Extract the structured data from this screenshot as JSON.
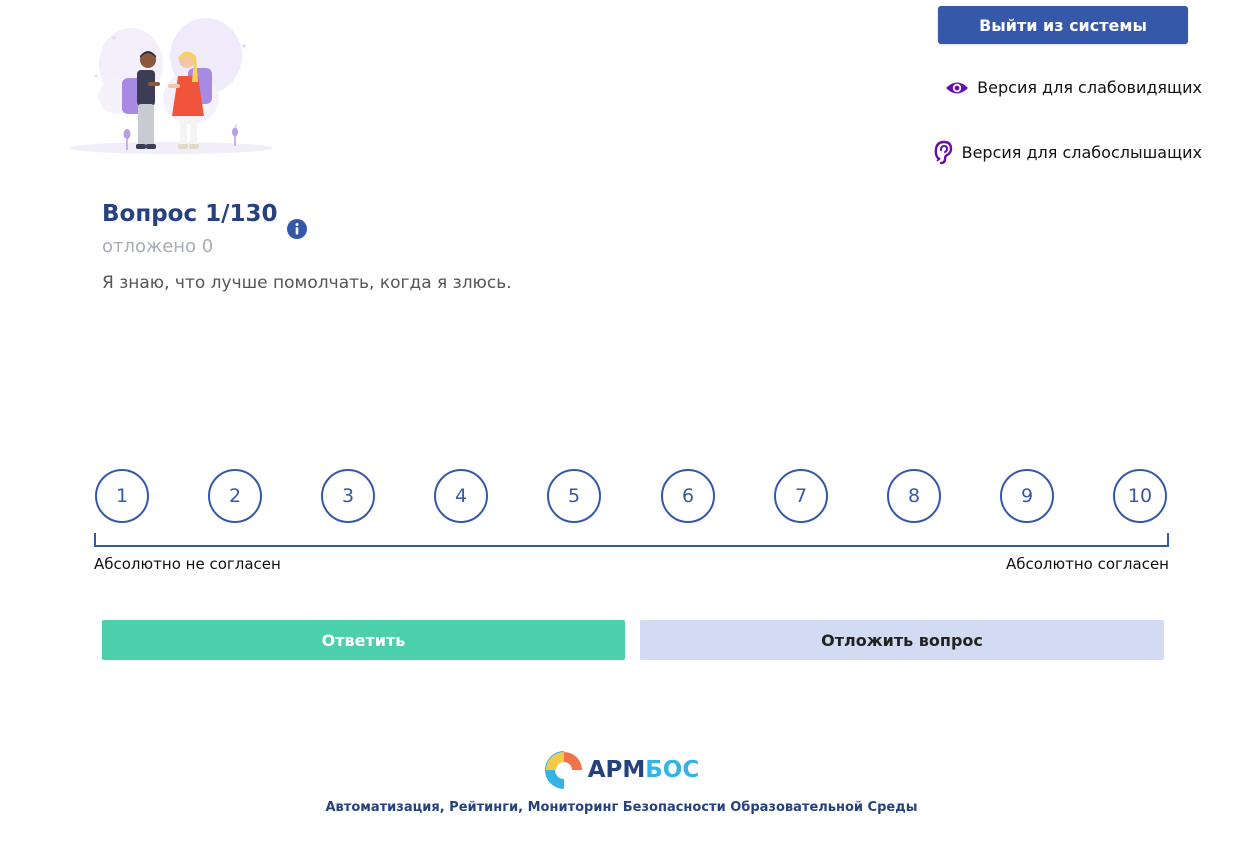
{
  "header": {
    "logout_label": "Выйти из системы",
    "vision_link_label": "Версия для слабовидящих",
    "hearing_link_label": "Версия для слабослышащих"
  },
  "question": {
    "title": "Вопрос 1/130",
    "postponed": "отложено 0",
    "text": "Я знаю, что лучше помолчать, когда я злюсь."
  },
  "scale": {
    "options": [
      "1",
      "2",
      "3",
      "4",
      "5",
      "6",
      "7",
      "8",
      "9",
      "10"
    ],
    "left_label": "Абсолютно не согласен",
    "right_label": "Абсолютно согласен"
  },
  "actions": {
    "answer_label": "Ответить",
    "postpone_label": "Отложить вопрос"
  },
  "footer": {
    "logo_part1": "АРМ",
    "logo_part2": "БОС",
    "tagline": "Автоматизация, Рейтинги, Мониторинг Безопасности Образовательной Среды"
  },
  "colors": {
    "primary": "#3558a8",
    "title": "#26427e",
    "answer": "#4ccfab",
    "postpone": "#d3dbf2",
    "accessibility_icon": "#6a0dad"
  }
}
